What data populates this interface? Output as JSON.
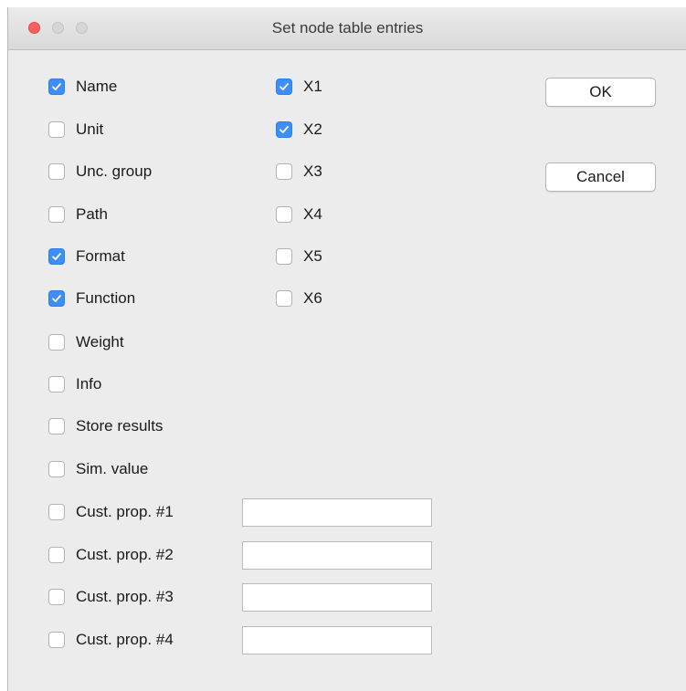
{
  "window": {
    "title": "Set node table entries"
  },
  "columns": {
    "left": [
      {
        "label": "Name",
        "checked": true
      },
      {
        "label": "Unit",
        "checked": false
      },
      {
        "label": "Unc. group",
        "checked": false
      },
      {
        "label": "Path",
        "checked": false
      },
      {
        "label": "Format",
        "checked": true
      },
      {
        "label": "Function",
        "checked": true
      },
      {
        "label": "Weight",
        "checked": false
      },
      {
        "label": "Info",
        "checked": false
      },
      {
        "label": "Store results",
        "checked": false
      },
      {
        "label": "Sim. value",
        "checked": false
      }
    ],
    "right": [
      {
        "label": "X1",
        "checked": true
      },
      {
        "label": "X2",
        "checked": true
      },
      {
        "label": "X3",
        "checked": false
      },
      {
        "label": "X4",
        "checked": false
      },
      {
        "label": "X5",
        "checked": false
      },
      {
        "label": "X6",
        "checked": false
      }
    ],
    "custom": [
      {
        "label": "Cust. prop. #1",
        "checked": false,
        "value": ""
      },
      {
        "label": "Cust. prop. #2",
        "checked": false,
        "value": ""
      },
      {
        "label": "Cust. prop. #3",
        "checked": false,
        "value": ""
      },
      {
        "label": "Cust. prop. #4",
        "checked": false,
        "value": ""
      }
    ]
  },
  "buttons": {
    "ok_label": "OK",
    "cancel_label": "Cancel"
  },
  "colors": {
    "accent": "#3e8ef7",
    "close_button": "#fc605c"
  },
  "icons": {
    "checkmark": "checkmark-icon"
  }
}
